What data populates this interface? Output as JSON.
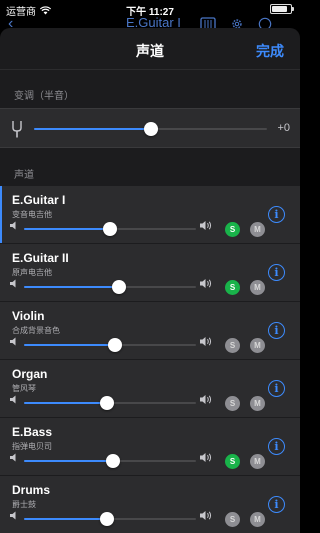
{
  "status_bar": {
    "carrier": "运营商",
    "time": "下午 11:27",
    "battery_level": 0.85
  },
  "background_nav": {
    "back_icon": "chevron-left-icon",
    "title": "E.Guitar I"
  },
  "sheet": {
    "title": "声道",
    "done_label": "完成"
  },
  "transpose": {
    "section_label": "变调（半音）",
    "value_label": "+0",
    "value": 0,
    "min": -12,
    "max": 12,
    "icon": "tuning-fork-icon"
  },
  "channels_section_label": "声道",
  "channels": [
    {
      "name": "E.Guitar I",
      "subtitle": "变音电吉他",
      "volume": 0.5,
      "solo": true,
      "solo_label": "S",
      "mute_label": "M",
      "selected": true
    },
    {
      "name": "E.Guitar II",
      "subtitle": "原声电吉他",
      "volume": 0.55,
      "solo": true,
      "solo_label": "S",
      "mute_label": "M",
      "selected": false
    },
    {
      "name": "Violin",
      "subtitle": "合成背景音色",
      "volume": 0.53,
      "solo": false,
      "solo_label": "S",
      "mute_label": "M",
      "selected": false
    },
    {
      "name": "Organ",
      "subtitle": "管风琴",
      "volume": 0.48,
      "solo": false,
      "solo_label": "S",
      "mute_label": "M",
      "selected": false
    },
    {
      "name": "E.Bass",
      "subtitle": "指弹电贝司",
      "volume": 0.52,
      "solo": true,
      "solo_label": "S",
      "mute_label": "M",
      "selected": false
    },
    {
      "name": "Drums",
      "subtitle": "爵士鼓",
      "volume": 0.48,
      "solo": false,
      "solo_label": "S",
      "mute_label": "M",
      "selected": false
    }
  ],
  "colors": {
    "accent": "#3d8bfd",
    "solo_on": "#19b34a",
    "button_off": "#8e8e93",
    "panel": "#2c2c2e",
    "sheet_bg": "#1c1c1e"
  }
}
